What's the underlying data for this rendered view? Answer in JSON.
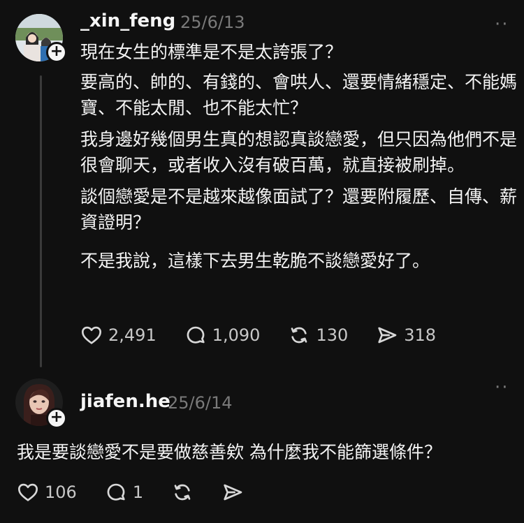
{
  "posts": [
    {
      "username": "_xin_feng",
      "timestamp": "25/6/13",
      "paragraphs": [
        "現在女生的標準是不是太誇張了？",
        "要高的、帥的、有錢的、會哄人、還要情緒穩定、不能媽寶、不能太閒、也不能太忙？",
        "我身邊好幾個男生真的想認真談戀愛，但只因為他們不是很會聊天，或者收入沒有破百萬，就直接被刷掉。",
        "談個戀愛是不是越來越像面試了？還要附履歷、自傳、薪資證明？",
        "不是我說，這樣下去男生乾脆不談戀愛好了。"
      ],
      "likes": "2,491",
      "comments": "1,090",
      "reposts": "130",
      "shares": "318"
    },
    {
      "username": "jiafen.he",
      "timestamp": "25/6/14",
      "text": "我是要談戀愛不是要做慈善欸 為什麼我不能篩選條件？",
      "likes": "106",
      "comments": "1"
    }
  ],
  "icons": {
    "like": "heart-icon",
    "comment": "comment-bubble-icon",
    "repost": "repost-icon",
    "share": "send-icon",
    "more": "more-dots-icon",
    "follow": "plus-icon"
  },
  "colors": {
    "background": "#101010",
    "text": "#f3f3f3",
    "muted": "#7a7a7a"
  }
}
